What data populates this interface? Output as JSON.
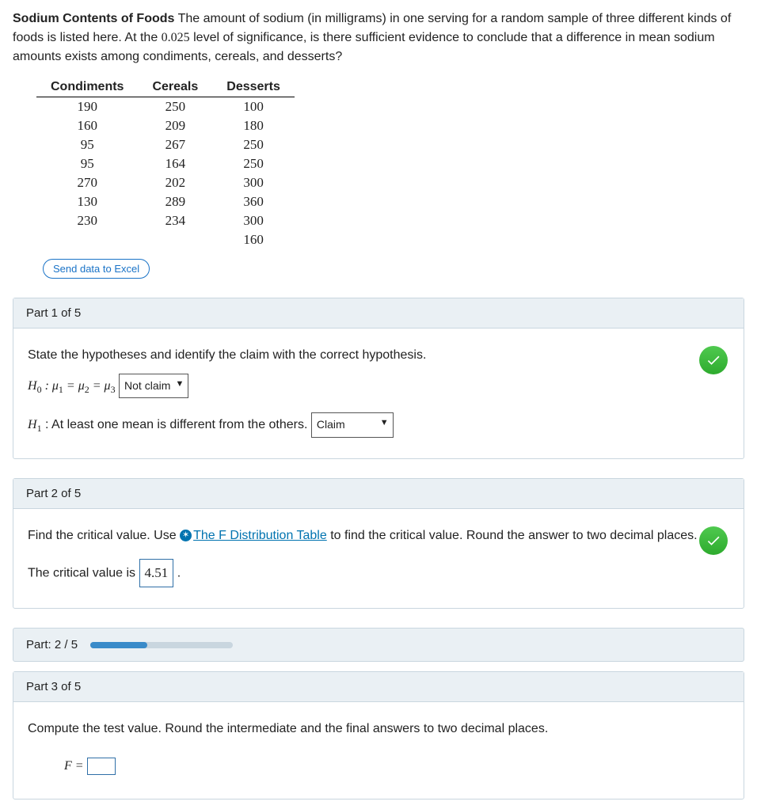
{
  "intro": {
    "title": "Sodium Contents of Foods",
    "text_a": " The amount of sodium (in milligrams) in one serving for a random sample of three different kinds of foods is listed here. At the ",
    "level": "0.025",
    "text_b": " level of significance, is there sufficient evidence to conclude that a difference in mean sodium amounts exists among condiments, cereals, and desserts?"
  },
  "table": {
    "headers": [
      "Condiments",
      "Cereals",
      "Desserts"
    ],
    "rows": [
      [
        "190",
        "250",
        "100"
      ],
      [
        "160",
        "209",
        "180"
      ],
      [
        "95",
        "267",
        "250"
      ],
      [
        "95",
        "164",
        "250"
      ],
      [
        "270",
        "202",
        "300"
      ],
      [
        "130",
        "289",
        "360"
      ],
      [
        "230",
        "234",
        "300"
      ],
      [
        "",
        "",
        "160"
      ]
    ]
  },
  "excel_btn": "Send data to Excel",
  "part1": {
    "header": "Part 1 of 5",
    "prompt": "State the hypotheses and identify the claim with the correct hypothesis.",
    "h0_select": "Not claim",
    "h1_text": " : At least one mean is different from the others. ",
    "h1_select": "Claim"
  },
  "part2": {
    "header": "Part 2 of 5",
    "prompt_a": "Find the critical value. Use ",
    "link": "The F Distribution Table",
    "prompt_b": " to find the critical value. Round the answer to two decimal places.",
    "answer_label": "The critical value is ",
    "answer_value": "4.51",
    "period": "."
  },
  "progress": {
    "label": "Part: 2 / 5"
  },
  "part3": {
    "header": "Part 3 of 5",
    "prompt": "Compute the test value. Round the intermediate and the final answers to two decimal places.",
    "f_label": "F ="
  },
  "chart_data": {
    "type": "table",
    "title": "Sodium Contents of Foods (mg per serving)",
    "series": [
      {
        "name": "Condiments",
        "values": [
          190,
          160,
          95,
          95,
          270,
          130,
          230
        ]
      },
      {
        "name": "Cereals",
        "values": [
          250,
          209,
          267,
          164,
          202,
          289,
          234
        ]
      },
      {
        "name": "Desserts",
        "values": [
          100,
          180,
          250,
          250,
          300,
          360,
          300,
          160
        ]
      }
    ],
    "alpha": 0.025,
    "critical_value": 4.51
  }
}
